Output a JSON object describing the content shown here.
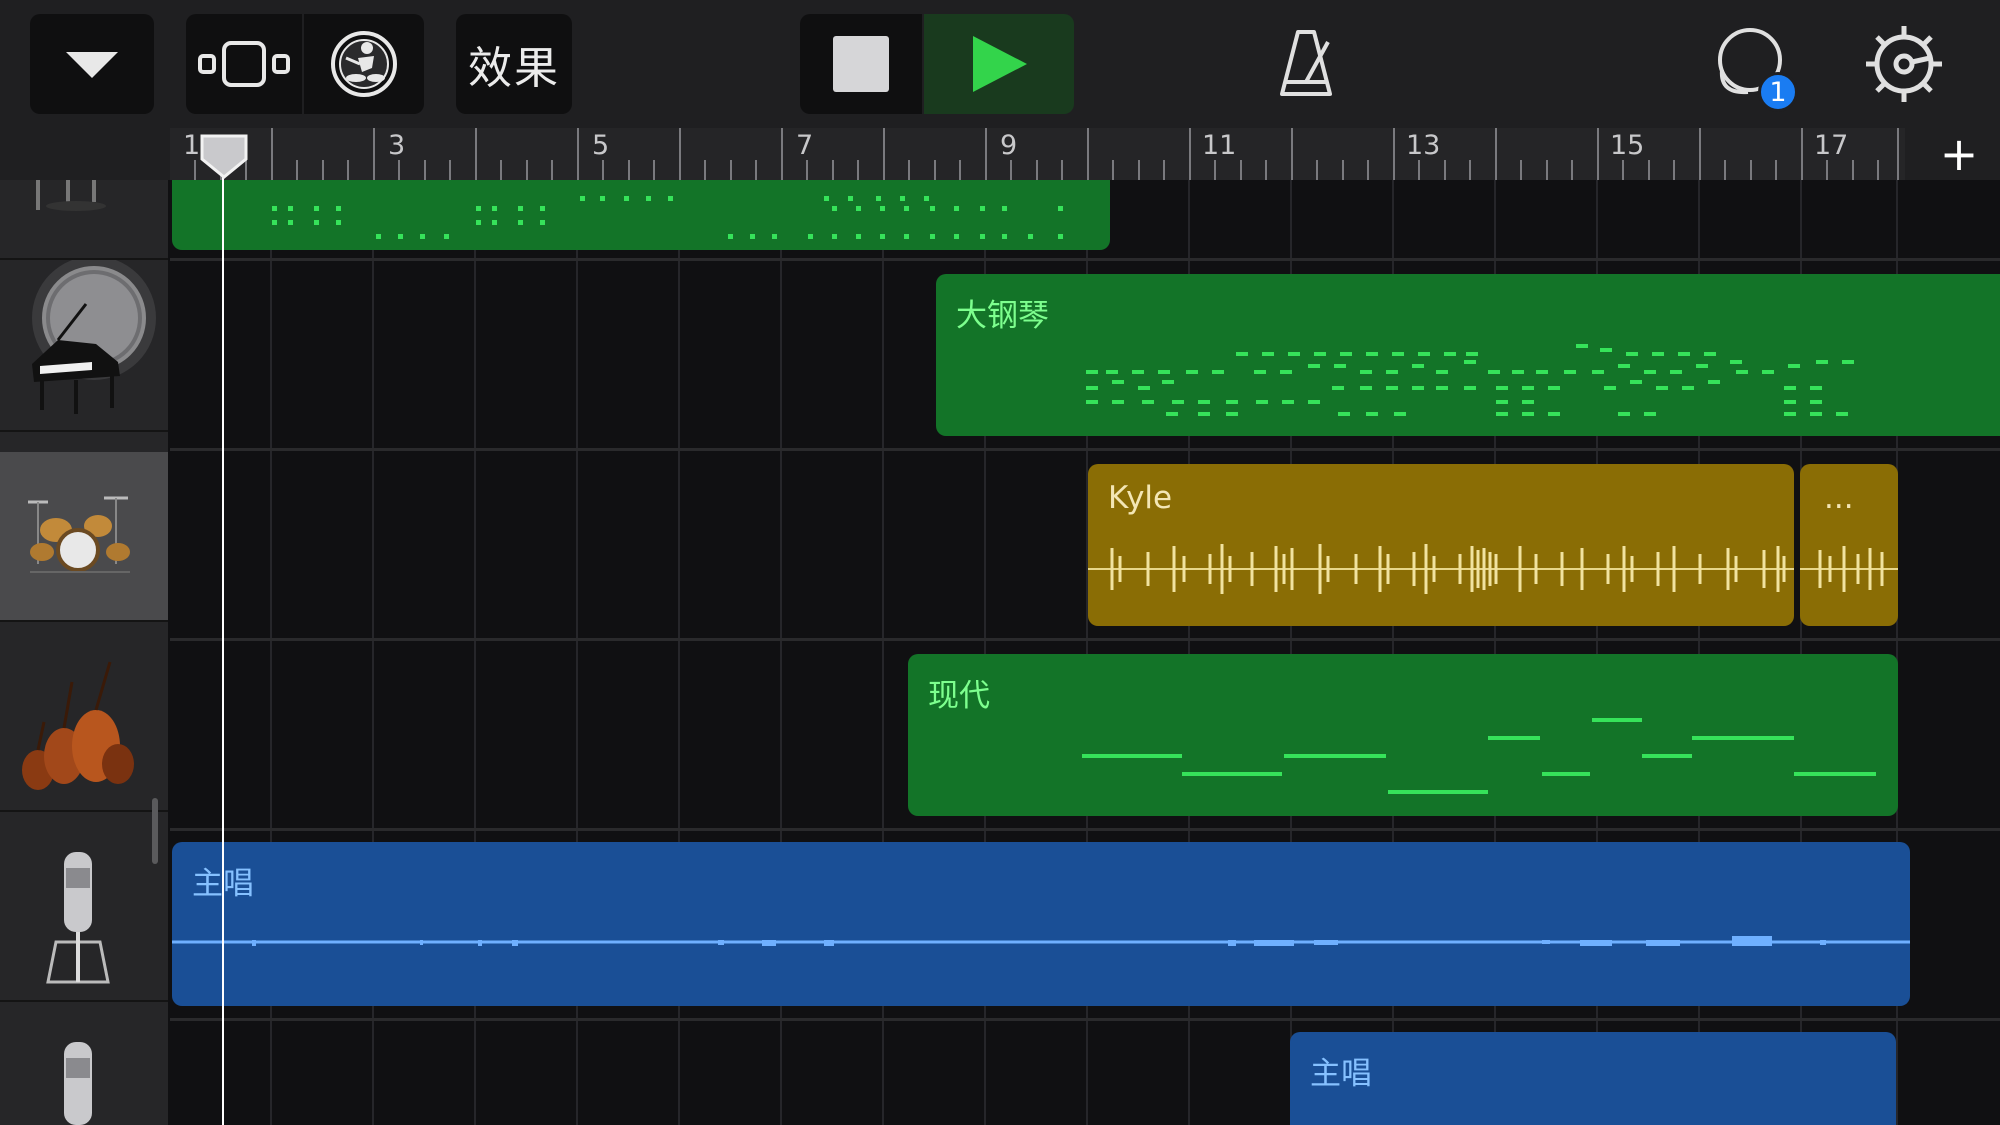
{
  "toolbar": {
    "effects_label": "效果",
    "notification_count": "1",
    "accent_play": "#33d44b"
  },
  "ruler": {
    "bar_numbers": [
      "1",
      "3",
      "5",
      "7",
      "9",
      "11",
      "13",
      "15",
      "17"
    ],
    "add_track_label": "+"
  },
  "tracks": [
    {
      "instrument": "drum-kit-partial-icon",
      "region_label": ""
    },
    {
      "instrument": "grand-piano-icon",
      "region_label": "大钢琴"
    },
    {
      "instrument": "drum-kit-icon",
      "region_label": "Kyle",
      "extra_label": "..."
    },
    {
      "instrument": "strings-icon",
      "region_label": "现代"
    },
    {
      "instrument": "microphone-icon",
      "region_label": "主唱"
    },
    {
      "instrument": "microphone-icon",
      "region_label": "主唱"
    }
  ],
  "colors": {
    "midi_region": "#137428",
    "drummer_region": "#8a6d05",
    "audio_region": "#1a4f96"
  }
}
